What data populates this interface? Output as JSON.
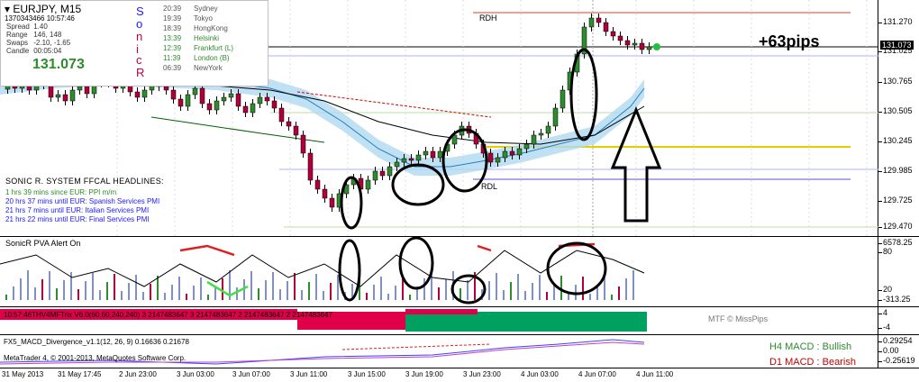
{
  "main_chart": {
    "symbol": "EURJPY",
    "timeframe": "M15",
    "instrument_id": "1370343466 10:57:46",
    "info_rows": [
      {
        "label": "Spread",
        "value": "1.40"
      },
      {
        "label": "Range",
        "value": "146, 148"
      },
      {
        "label": "Swaps",
        "value": "-2.10, -1.65"
      },
      {
        "label": "Candle",
        "value": "00:05:04"
      }
    ],
    "current_price": "131.073",
    "sonic_letters": [
      "S",
      "o",
      "n",
      "i",
      "c",
      "R"
    ],
    "sessions": [
      {
        "time": "20:39",
        "name": "Sydney",
        "color": "#555555"
      },
      {
        "time": "19:39",
        "name": "Tokyo",
        "color": "#555555"
      },
      {
        "time": "18:39",
        "name": "HongKong",
        "color": "#555555"
      },
      {
        "time": "13:39",
        "name": "Helsinki",
        "color": "#2e8b2e"
      },
      {
        "time": "12:39",
        "name": "Frankfurt  (L)",
        "color": "#2e8b2e"
      },
      {
        "time": "11:39",
        "name": "London  (B)",
        "color": "#2e8b2e"
      },
      {
        "time": "06:39",
        "name": "NewYork",
        "color": "#555555"
      }
    ],
    "headline_title": "SONIC R. SYSTEM  FFCAL HEADLINES:",
    "headlines": [
      {
        "text": "1 hrs 39 mins since EUR: PPI m/m",
        "color": "#2e8b2e"
      },
      {
        "text": "20 hrs 37 mins until EUR: Spanish Services PMI",
        "color": "#1a1aff"
      },
      {
        "text": "21 hrs 7 mins until EUR: Italian Services PMI",
        "color": "#1a1aff"
      },
      {
        "text": "21 hrs 22 mins until EUR: Final Services PMI",
        "color": "#1a1aff"
      }
    ],
    "pips_label": "+63pips",
    "rdh_label": "RDH",
    "rdl_label": "RDL",
    "price_axis": [
      "131.270",
      "131.025",
      "130.765",
      "130.505",
      "130.245",
      "129.985",
      "129.725",
      "129.470"
    ],
    "price_tag": "131.073"
  },
  "pva_pane": {
    "label": "SonicR PVA   Alert On",
    "axis": [
      "6578.25",
      "80",
      "20",
      "-313.25"
    ]
  },
  "trix_pane": {
    "label": "10:57:46THV4MFTrix V6.0(60,60,240,240) 3 2147483647 3 2147483647 2 2147483647 2 2147483647",
    "credit": "MTF © MissPips",
    "axis": [
      "4",
      "-4"
    ]
  },
  "macd_pane": {
    "label": "FX5_MACD_Divergence_v1.1(12, 26, 9) 0.16636 0.21678",
    "copyright": "MetaTrader 4, © 2001-2013, MetaQuotes Software Corp.",
    "status_h4": "H4 MACD : Bullish",
    "status_d1": "D1 MACD : Bearish",
    "axis": [
      "0.29254",
      "0.00",
      "-0.25619"
    ]
  },
  "time_axis": [
    "31 May 2013",
    "31 May 17:45",
    "2 Jun 23:00",
    "3 Jun 03:00",
    "3 Jun 07:00",
    "3 Jun 11:00",
    "3 Jun 15:00",
    "3 Jun 19:00",
    "3 Jun 23:00",
    "4 Jun 03:00",
    "4 Jun 07:00",
    "4 Jun 11:00"
  ],
  "colors": {
    "bull_candle": "#2e8b2e",
    "bear_candle": "#b0003a",
    "band": "#b0d8f0",
    "trix_red": "#e0004a",
    "trix_green": "#00a060"
  }
}
